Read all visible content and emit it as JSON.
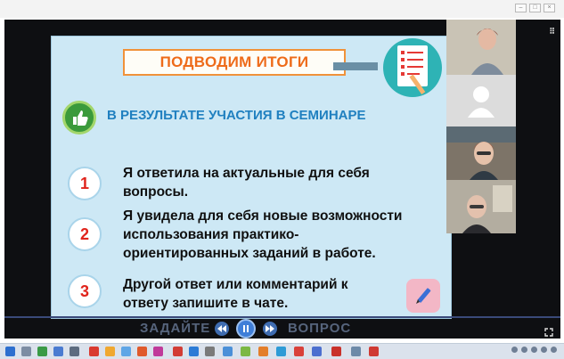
{
  "slide": {
    "title": "ПОДВОДИМ ИТОГИ",
    "heading": "В РЕЗУЛЬТАТЕ УЧАСТИЯ В СЕМИНАРЕ",
    "items": [
      {
        "number": "1",
        "text": "Я ответила на актуальные для себя\nвопросы."
      },
      {
        "number": "2",
        "text": "Я увидела для себя новые возможности\nиспользования практико-\nориентированных заданий в работе."
      },
      {
        "number": "3",
        "text": "Другой ответ или комментарий к\nответу запишите в чате."
      }
    ]
  },
  "player": {
    "caption_left": "ЗАДАЙТЕ",
    "caption_right": "ВОПРОС"
  },
  "colors": {
    "title_orange": "#ee6b1a",
    "heading_blue": "#2080c0",
    "number_red": "#e0241c",
    "slide_bg": "#cde8f5"
  },
  "icons": [
    "checklist-icon",
    "thumbs-up-icon",
    "pen-icon",
    "play-pause-icon",
    "rewind-icon",
    "forward-icon",
    "fullscreen-icon",
    "grid-icon"
  ]
}
